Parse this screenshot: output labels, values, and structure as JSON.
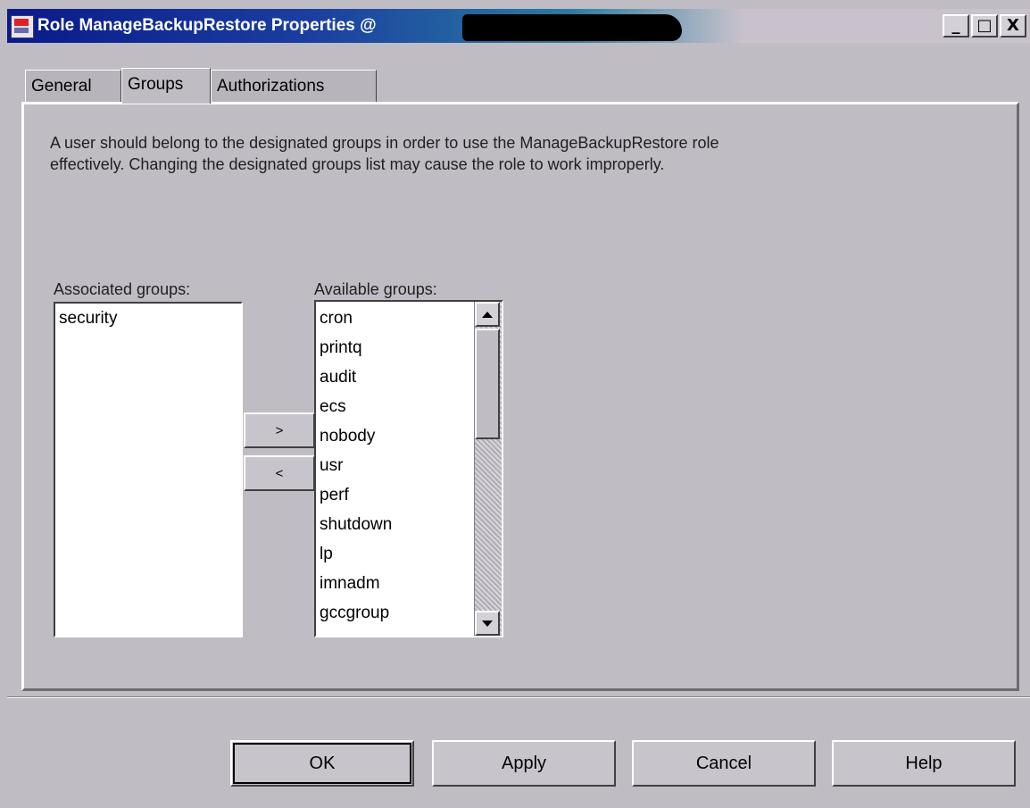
{
  "window": {
    "title": "Role ManageBackupRestore Properties @",
    "controls": {
      "minimize": "_",
      "maximize": "□",
      "close": "X"
    }
  },
  "tabs": [
    {
      "label": "General",
      "active": false
    },
    {
      "label": "Groups",
      "active": true
    },
    {
      "label": "Authorizations",
      "active": false
    }
  ],
  "description": "A user should belong to the designated groups in order to use the ManageBackupRestore role effectively. Changing the designated groups list may cause the role to work improperly.",
  "associated": {
    "label": "Associated groups:",
    "items": [
      "security"
    ]
  },
  "available": {
    "label": "Available groups:",
    "items": [
      "cron",
      "printq",
      "audit",
      "ecs",
      "nobody",
      "usr",
      "perf",
      "shutdown",
      "lp",
      "imnadm",
      "gccgroup"
    ]
  },
  "move_buttons": {
    "add": ">",
    "remove": "<"
  },
  "footer": {
    "ok": "OK",
    "apply": "Apply",
    "cancel": "Cancel",
    "help": "Help"
  }
}
